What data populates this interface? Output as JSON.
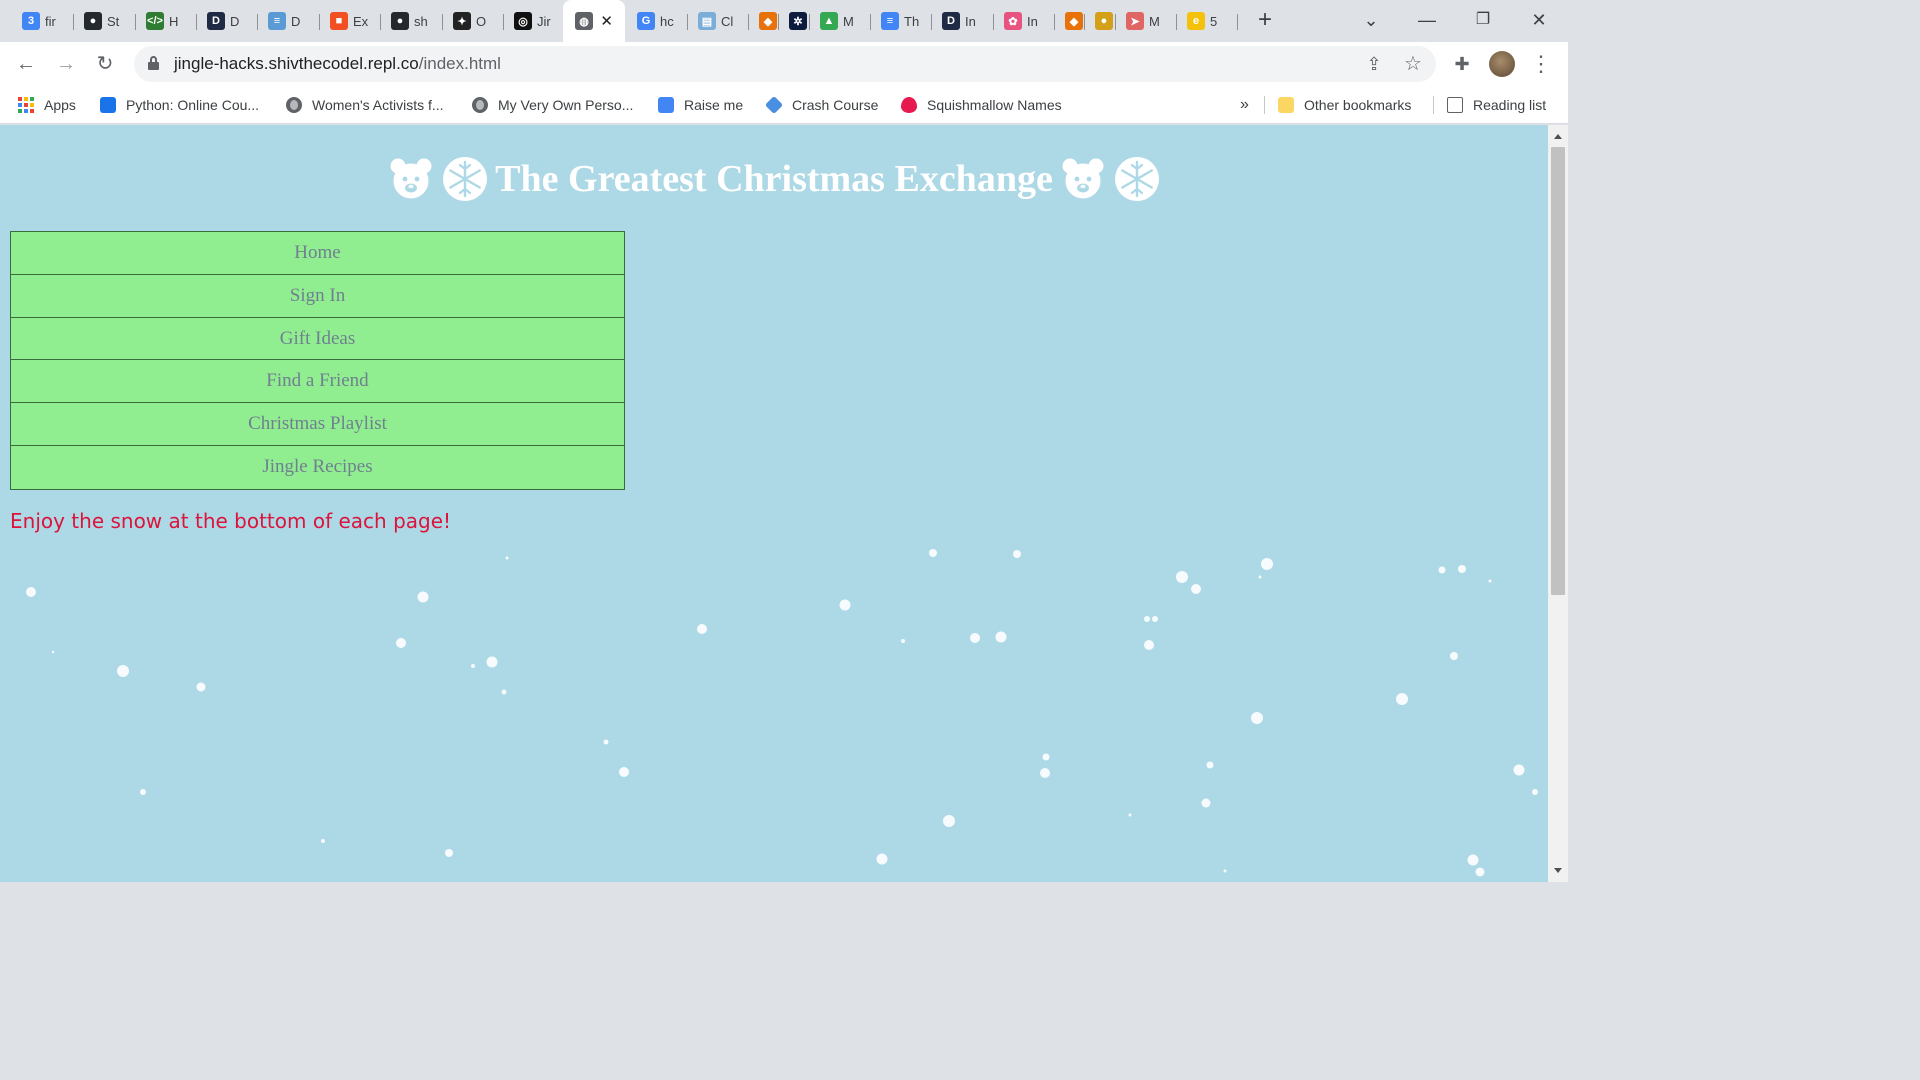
{
  "browser": {
    "tabs": [
      {
        "title": "fir",
        "icon": "chrome-badge-icon",
        "color": "#4285f4",
        "glyph": "3"
      },
      {
        "title": "St",
        "icon": "github-icon",
        "color": "#24292e",
        "glyph": "●"
      },
      {
        "title": "H",
        "icon": "code-icon",
        "color": "#2e7d32",
        "glyph": "</>"
      },
      {
        "title": "D",
        "icon": "d-logo-icon",
        "color": "#1f2a44",
        "glyph": "D"
      },
      {
        "title": "D",
        "icon": "stack-icon",
        "color": "#5b9bd5",
        "glyph": "≡"
      },
      {
        "title": "Ex",
        "icon": "microsoft-icon",
        "color": "#f25022",
        "glyph": "■"
      },
      {
        "title": "sh",
        "icon": "github-icon",
        "color": "#24292e",
        "glyph": "●"
      },
      {
        "title": "O",
        "icon": "sparkle-icon",
        "color": "#222222",
        "glyph": "✦"
      },
      {
        "title": "Jir",
        "icon": "replit-icon",
        "color": "#111111",
        "glyph": "◎"
      },
      {
        "title": "",
        "icon": "globe-icon",
        "color": "#5f6368",
        "glyph": "◍"
      },
      {
        "title": "hc",
        "icon": "google-icon",
        "color": "#4285f4",
        "glyph": "G"
      },
      {
        "title": "Cl",
        "icon": "image-icon",
        "color": "#7aaed8",
        "glyph": "▤"
      },
      {
        "title": "",
        "icon": "shield-icon",
        "color": "#e8710a",
        "glyph": "◆"
      },
      {
        "title": "",
        "icon": "gear-icon",
        "color": "#0d1b3e",
        "glyph": "✲"
      },
      {
        "title": "M",
        "icon": "drive-icon",
        "color": "#34a853",
        "glyph": "▲"
      },
      {
        "title": "Th",
        "icon": "docs-icon",
        "color": "#4285f4",
        "glyph": "≡"
      },
      {
        "title": "In",
        "icon": "d-logo-icon",
        "color": "#1f2a44",
        "glyph": "D"
      },
      {
        "title": "In",
        "icon": "flower-icon",
        "color": "#e75480",
        "glyph": "✿"
      },
      {
        "title": "",
        "icon": "shield-icon",
        "color": "#e8710a",
        "glyph": "◆"
      },
      {
        "title": "",
        "icon": "coin-icon",
        "color": "#d4a017",
        "glyph": "●"
      },
      {
        "title": "M",
        "icon": "bird-icon",
        "color": "#e06666",
        "glyph": "➤"
      },
      {
        "title": "5",
        "icon": "e-icon",
        "color": "#f4c20d",
        "glyph": "e"
      }
    ],
    "active_tab_close": "✕",
    "new_tab": "+",
    "window_controls": {
      "tab_search": "⌄",
      "minimize": "—",
      "restore": "❐",
      "close": "✕"
    },
    "url_host": "jingle-hacks.shivthecodel.repl.co",
    "url_path": "/index.html",
    "toolbar_icons": {
      "back": "←",
      "forward": "→",
      "reload": "↻",
      "share": "⇪",
      "star": "☆",
      "extensions": "✚",
      "menu": "⋮"
    },
    "bookmarks": [
      {
        "label": "Apps",
        "icon": "apps-grid-icon"
      },
      {
        "label": "Python: Online Cou...",
        "icon": "video-icon",
        "color": "#1a73e8"
      },
      {
        "label": "Women's Activists f...",
        "icon": "globe-icon"
      },
      {
        "label": "My Very Own Perso...",
        "icon": "globe-icon"
      },
      {
        "label": "Raise me",
        "icon": "profile-icon",
        "color": "#4285f4"
      },
      {
        "label": "Crash Course",
        "icon": "diamond-icon",
        "color": "#4a90e2"
      },
      {
        "label": "Squishmallow Names",
        "icon": "flame-icon",
        "color": "#e8194f"
      }
    ],
    "bookmarks_overflow": "»",
    "other_bookmarks": "Other bookmarks",
    "reading_list": "Reading list"
  },
  "page": {
    "title": "The Greatest Christmas Exchange",
    "nav": [
      "Home",
      "Sign In",
      "Gift Ideas",
      "Find a Friend",
      "Christmas Playlist",
      "Jingle Recipes"
    ],
    "snow_note": "Enjoy the snow at the bottom of each page!",
    "colors": {
      "background": "#add8e6",
      "nav_bg": "#90ee90",
      "nav_text": "#708090",
      "note_text": "#dc143c",
      "title_text": "#ffffff"
    }
  }
}
